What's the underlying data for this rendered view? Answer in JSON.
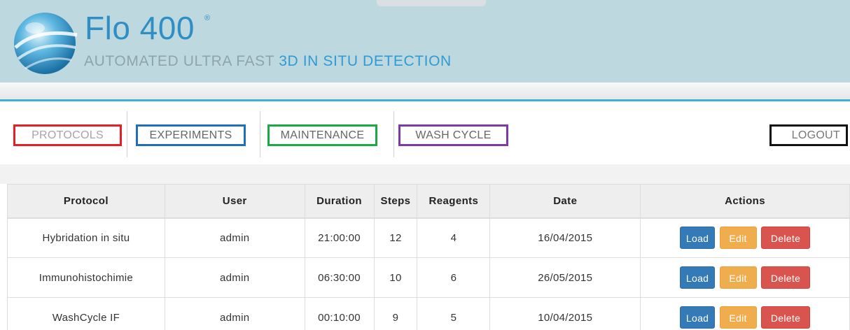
{
  "brand": {
    "name": "Flo 400",
    "registered_mark": "®",
    "tagline_part1": "AUTOMATED ULTRA FAST ",
    "tagline_part2": "3D IN SITU DETECTION"
  },
  "nav": {
    "protocols": "PROTOCOLS",
    "experiments": "EXPERIMENTS",
    "maintenance": "MAINTENANCE",
    "wash_cycle": "WASH CYCLE",
    "logout": "LOGOUT"
  },
  "table": {
    "headers": {
      "protocol": "Protocol",
      "user": "User",
      "duration": "Duration",
      "steps": "Steps",
      "reagents": "Reagents",
      "date": "Date",
      "actions": "Actions"
    },
    "rows": [
      {
        "protocol": "Hybridation in situ",
        "user": "admin",
        "duration": "21:00:00",
        "steps": "12",
        "reagents": "4",
        "date": "16/04/2015"
      },
      {
        "protocol": "Immunohistochimie",
        "user": "admin",
        "duration": "06:30:00",
        "steps": "10",
        "reagents": "6",
        "date": "26/05/2015"
      },
      {
        "protocol": "WashCycle IF",
        "user": "admin",
        "duration": "00:10:00",
        "steps": "9",
        "reagents": "5",
        "date": "10/04/2015"
      }
    ],
    "actions": {
      "load": "Load",
      "edit": "Edit",
      "delete": "Delete"
    }
  },
  "colors": {
    "header_bg": "#bed8e0",
    "brand_blue": "#2f8fc4",
    "accent_line": "#3ab2dc",
    "protocols_border": "#e41f26",
    "experiments_border": "#1f6fbd",
    "maintenance_border": "#19a945",
    "wash_border": "#7d3aa6",
    "logout_border": "#111111",
    "load_btn": "#337ab7",
    "edit_btn": "#f0ad4e",
    "delete_btn": "#d9534f"
  }
}
